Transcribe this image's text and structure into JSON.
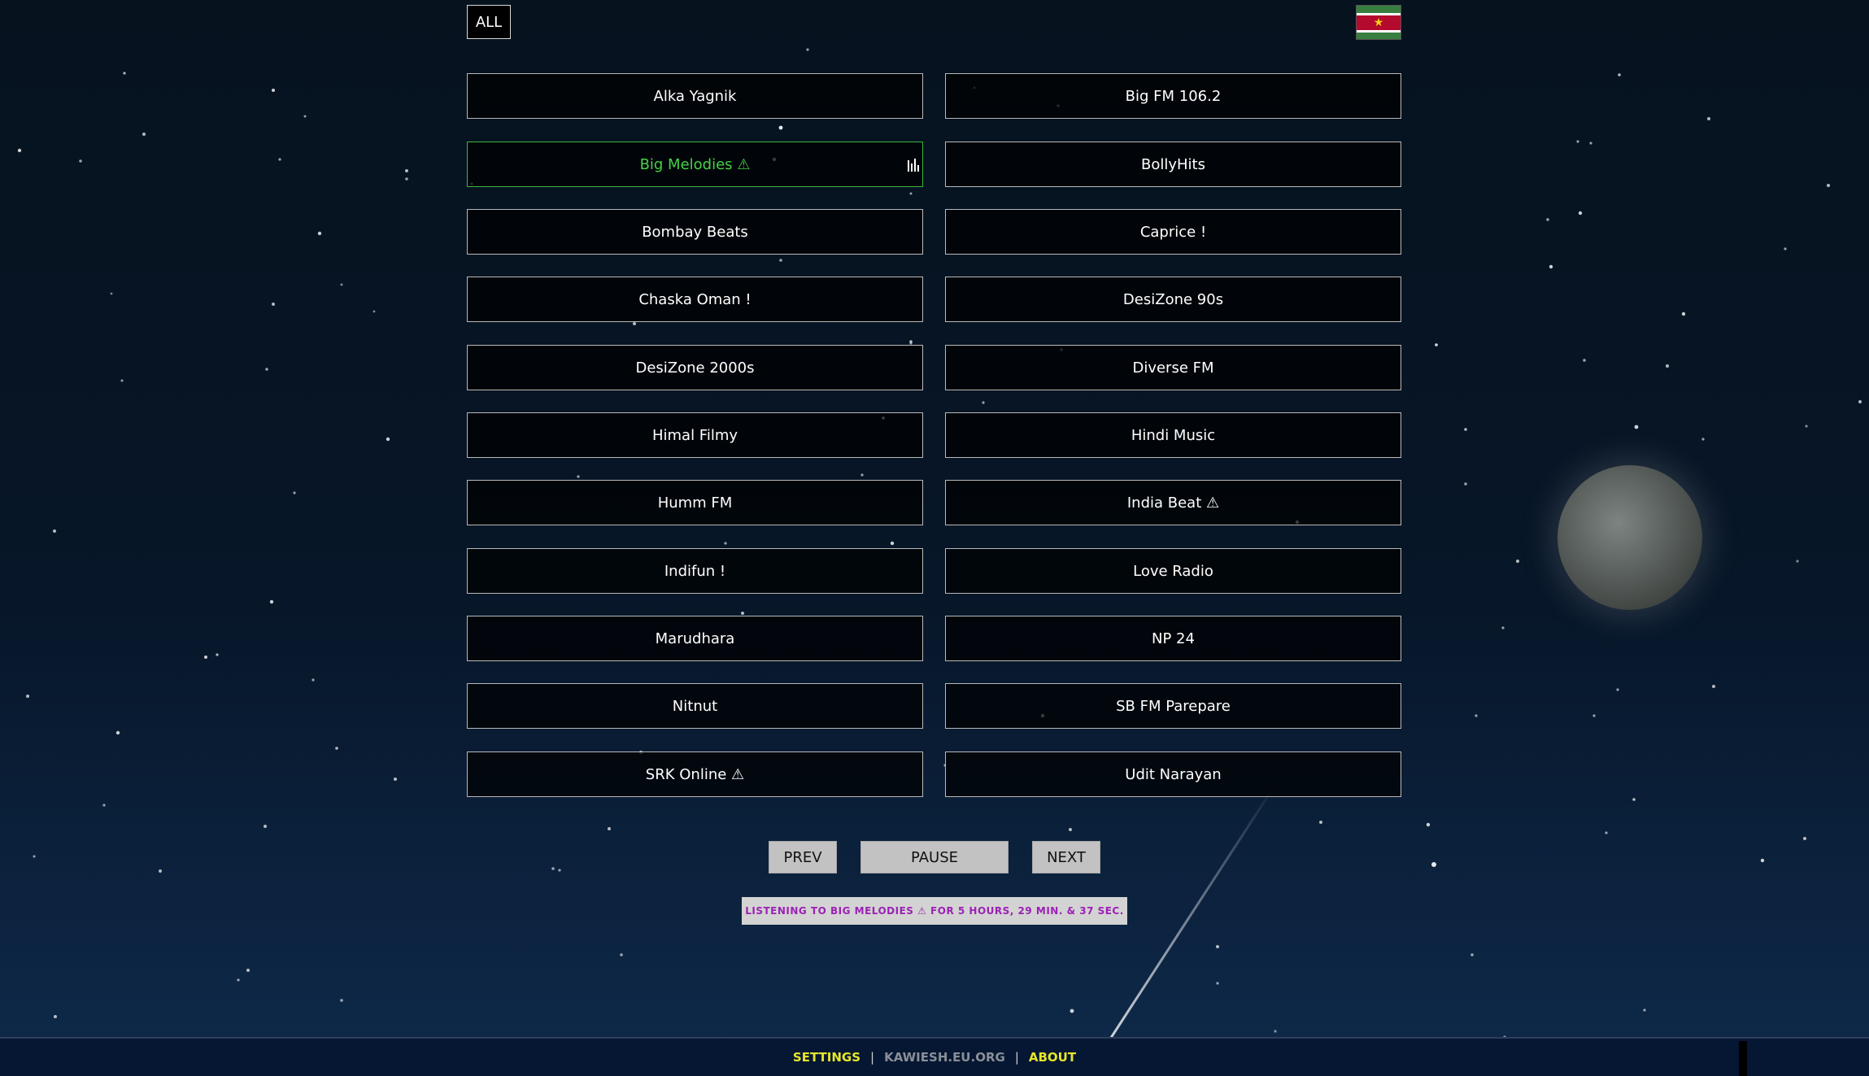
{
  "header": {
    "filter_label": "ALL",
    "flag_icon": "suriname-flag-icon"
  },
  "stations": {
    "items": [
      {
        "label": "Alka Yagnik"
      },
      {
        "label": "Big FM 106.2"
      },
      {
        "label": "Big Melodies ⚠",
        "active": true,
        "playing_icon": "equalizer-icon"
      },
      {
        "label": "BollyHits"
      },
      {
        "label": "Bombay Beats"
      },
      {
        "label": "Caprice !"
      },
      {
        "label": "Chaska Oman !"
      },
      {
        "label": "DesiZone 90s"
      },
      {
        "label": "DesiZone 2000s"
      },
      {
        "label": "Diverse FM"
      },
      {
        "label": "Himal Filmy"
      },
      {
        "label": "Hindi Music"
      },
      {
        "label": "Humm FM"
      },
      {
        "label": "India Beat ⚠"
      },
      {
        "label": "Indifun !"
      },
      {
        "label": "Love Radio"
      },
      {
        "label": "Marudhara"
      },
      {
        "label": "NP 24"
      },
      {
        "label": "Nitnut"
      },
      {
        "label": "SB FM Parepare"
      },
      {
        "label": "SRK Online ⚠"
      },
      {
        "label": "Udit Narayan"
      }
    ]
  },
  "controls": {
    "prev_label": "PREV",
    "pause_label": "PAUSE",
    "next_label": "NEXT"
  },
  "status": {
    "text": "LISTENING TO BIG MELODIES ⚠ FOR 5 HOURS, 29 MIN. & 37 SEC."
  },
  "footer": {
    "settings_label": "SETTINGS",
    "site_label": "KAWIESH.EU.ORG",
    "about_label": "ABOUT"
  },
  "colors": {
    "active_green": "#47d147",
    "status_purple": "#9b21b5",
    "footer_yellow": "#e6e62a"
  }
}
